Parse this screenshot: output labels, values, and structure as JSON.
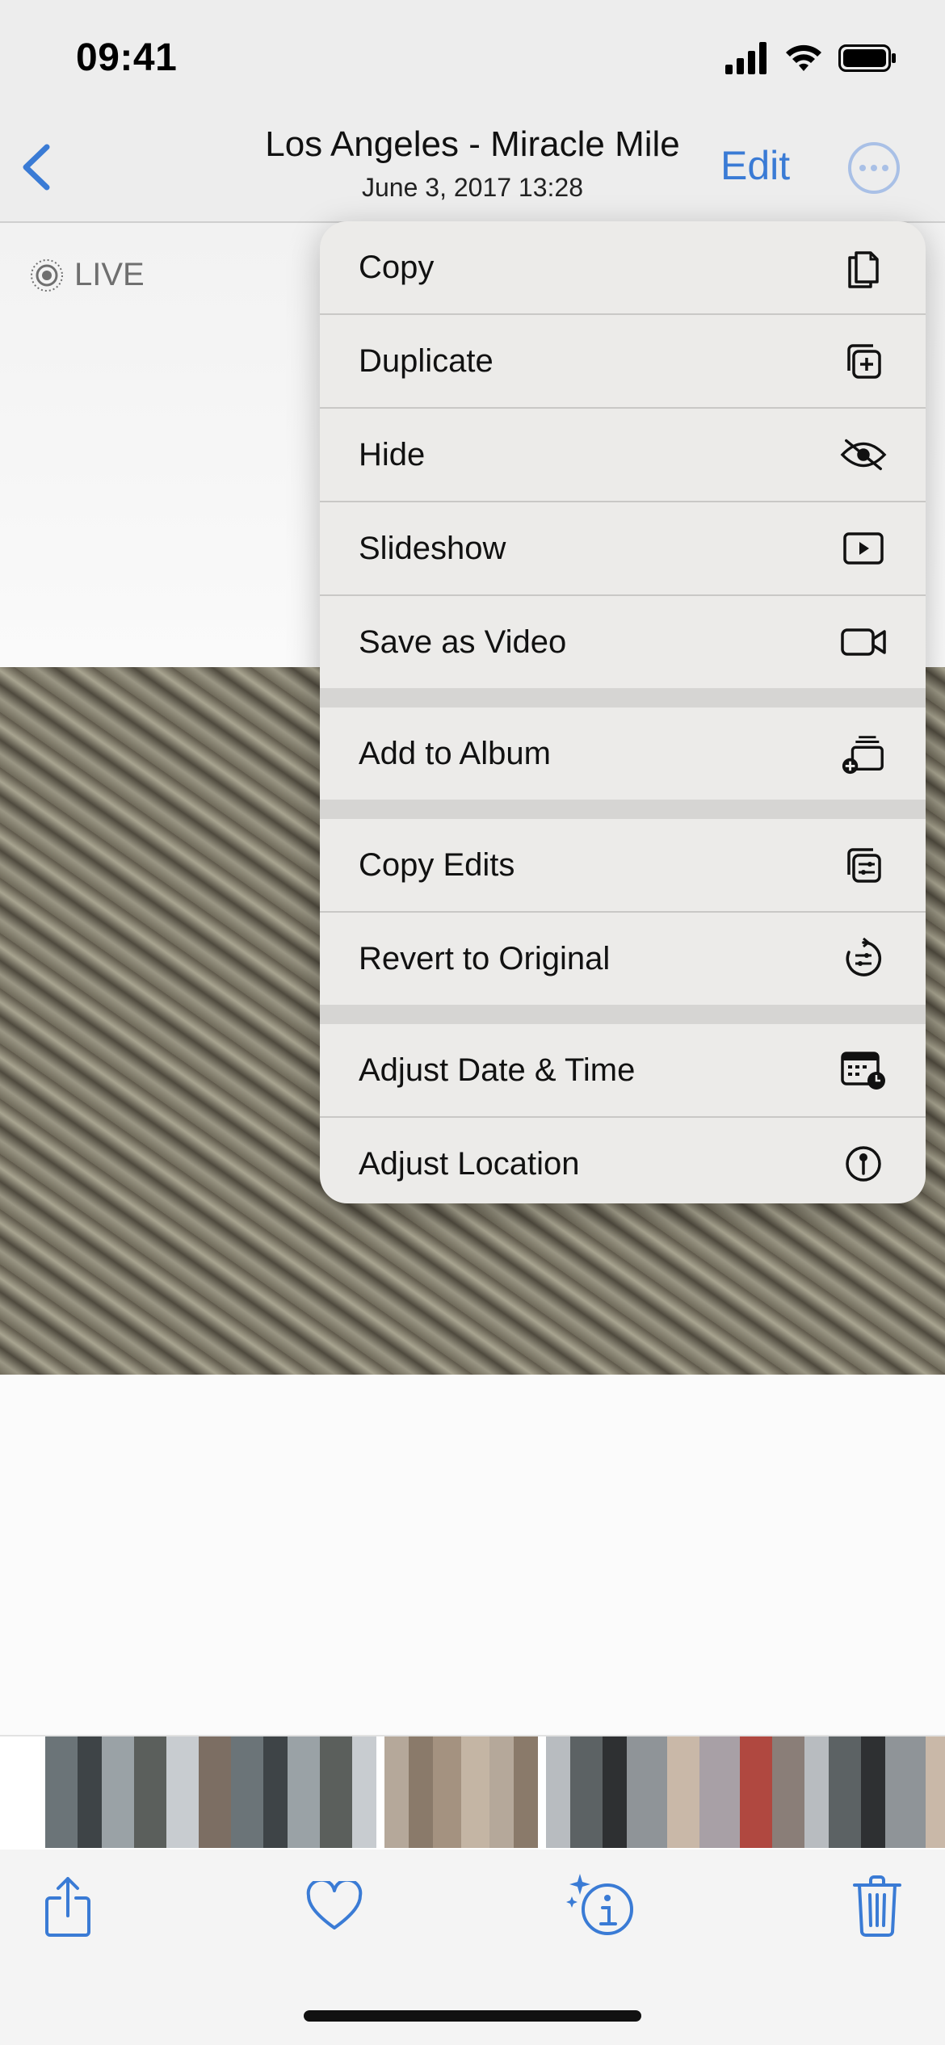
{
  "status_bar": {
    "time": "09:41",
    "icons": [
      "cellular-signal-icon",
      "wifi-icon",
      "battery-icon"
    ]
  },
  "nav": {
    "title": "Los Angeles - Miracle Mile",
    "subtitle": "June 3, 2017  13:28",
    "edit_label": "Edit",
    "back_icon": "chevron-left-icon",
    "more_icon": "ellipsis-circle-icon"
  },
  "photo": {
    "live_label": "LIVE",
    "live_icon": "live-photo-icon"
  },
  "menu": {
    "items": [
      {
        "label": "Copy",
        "icon": "copy-icon"
      },
      {
        "label": "Duplicate",
        "icon": "duplicate-icon"
      },
      {
        "label": "Hide",
        "icon": "eye-slash-icon"
      },
      {
        "label": "Slideshow",
        "icon": "slideshow-icon"
      },
      {
        "label": "Save as Video",
        "icon": "video-camera-icon"
      },
      {
        "label": "Add to Album",
        "icon": "add-to-album-icon"
      },
      {
        "label": "Copy Edits",
        "icon": "copy-edits-icon"
      },
      {
        "label": "Revert to Original",
        "icon": "revert-icon"
      },
      {
        "label": "Adjust Date & Time",
        "icon": "calendar-clock-icon"
      },
      {
        "label": "Adjust Location",
        "icon": "location-pin-icon"
      }
    ]
  },
  "toolbar": {
    "icons": [
      "share-icon",
      "heart-icon",
      "info-sparkle-icon",
      "trash-icon"
    ]
  },
  "colors": {
    "accent": "#3a7bd5",
    "menu_bg": "#ecebe9",
    "bar_bg": "#ededed"
  }
}
